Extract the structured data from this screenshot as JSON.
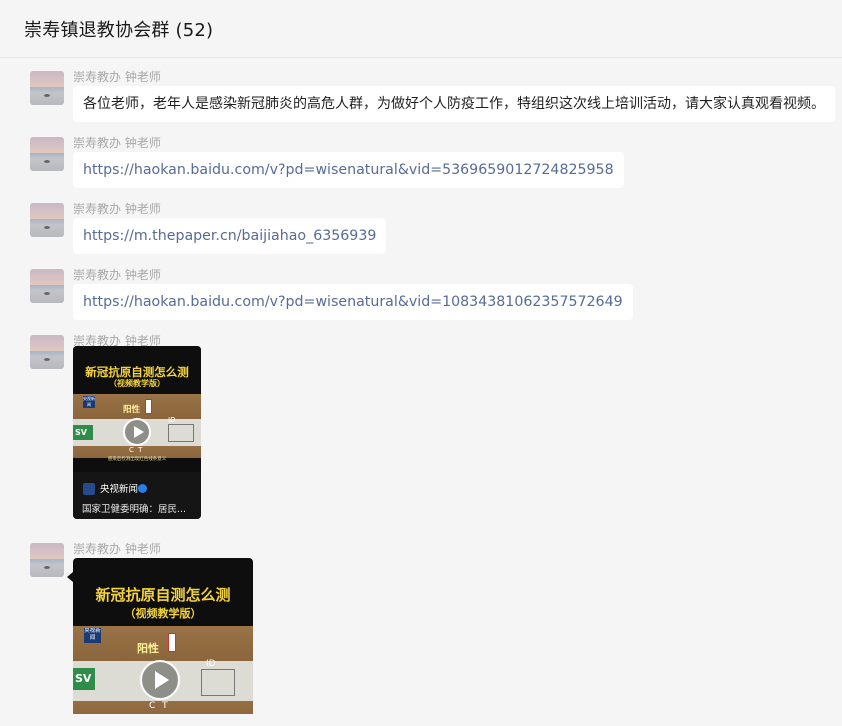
{
  "header": {
    "title": "崇寿镇退教协会群 (52)"
  },
  "messages": [
    {
      "sender": "崇寿教办 钟老师",
      "text": "各位老师，老年人是感染新冠肺炎的高危人群，为做好个人防疫工作，特组织这次线上培训活动，请大家认真观看视频。"
    },
    {
      "sender": "崇寿教办 钟老师",
      "link": "https://haokan.baidu.com/v?pd=wisenatural&vid=5369659012724825958"
    },
    {
      "sender": "崇寿教办 钟老师",
      "link": "https://m.thepaper.cn/baijiahao_6356939"
    },
    {
      "sender": "崇寿教办 钟老师",
      "link": "https://haokan.baidu.com/v?pd=wisenatural&vid=10834381062357572649"
    },
    {
      "sender": "崇寿教办 钟老师",
      "video": {
        "title_line1": "新冠抗原自测怎么测",
        "title_line2": "（视频教学版）",
        "badge": "央视新闻",
        "label_positive": "阳性",
        "strip_sv": "SV",
        "strip_id": "ID",
        "strip_ct": "C  T",
        "subtitle": "感染后检测出现红色线条意义",
        "channel": "央视新闻",
        "caption": "国家卫健委明确：居民..."
      }
    },
    {
      "sender": "崇寿教办 钟老师",
      "video": {
        "title_line1": "新冠抗原自测怎么测",
        "title_line2": "（视频教学版）",
        "badge": "央视新闻",
        "label_positive": "阳性",
        "strip_sv": "SV",
        "strip_id": "ID",
        "strip_ct": "C  T"
      }
    }
  ],
  "colors": {
    "link": "#576b95",
    "background": "#f5f5f5",
    "bubble": "#ffffff",
    "sender": "#a8a8a8"
  },
  "icons": {
    "play": "play-icon",
    "verified": "verified-icon"
  }
}
